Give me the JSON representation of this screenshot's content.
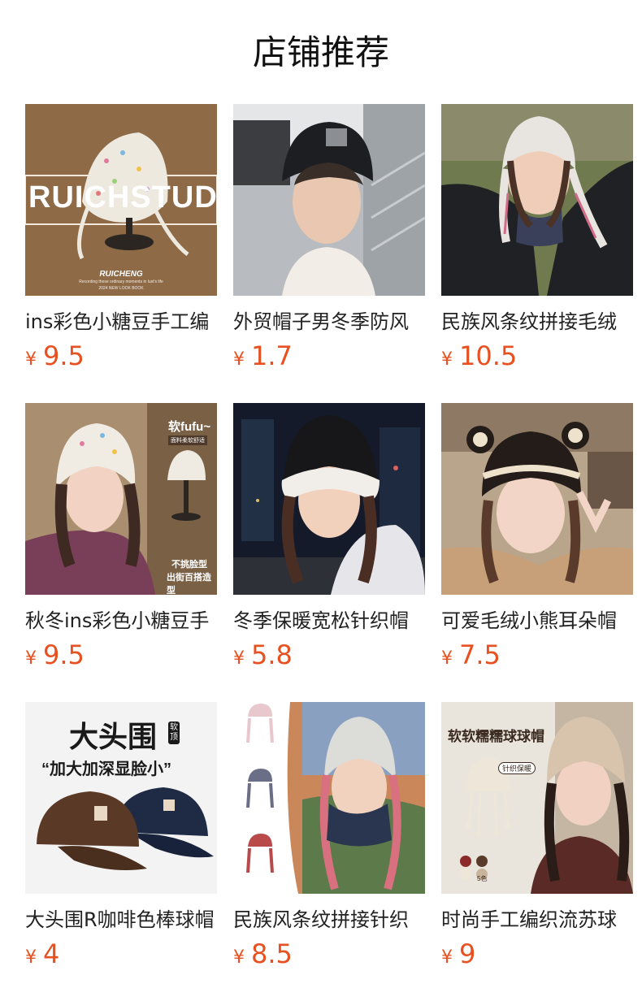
{
  "page": {
    "title": "店铺推荐"
  },
  "currency": "¥",
  "colors": {
    "price": "#e8511f",
    "text": "#222222"
  },
  "products": [
    {
      "name": "ins彩色小糖豆手工编",
      "price": "9.5",
      "image": {
        "icon": "knit-beanie-image",
        "overlay_big": "RUICHSTUDIO",
        "overlay_brand": "RUICHENG",
        "overlay_small": "Recording these ordinary moments in lust's life",
        "overlay_sub": "2024 NEW LOOK BOOK"
      }
    },
    {
      "name": "外贸帽子男冬季防风",
      "price": "1.7",
      "image": {
        "icon": "black-beanie-model-image"
      }
    },
    {
      "name": "民族风条纹拼接毛绒",
      "price": "10.5",
      "image": {
        "icon": "earflap-hat-model-image"
      }
    },
    {
      "name": "秋冬ins彩色小糖豆手",
      "price": "9.5",
      "image": {
        "icon": "fluffy-hat-model-image",
        "overlay_title": "软fufu~",
        "overlay_tag": "面料柔软舒适",
        "overlay_line1": "不挑脸型",
        "overlay_line2": "出街百搭造型"
      }
    },
    {
      "name": "冬季保暖宽松针织帽",
      "price": "5.8",
      "image": {
        "icon": "two-tone-knit-hat-image"
      }
    },
    {
      "name": "可爱毛绒小熊耳朵帽",
      "price": "7.5",
      "image": {
        "icon": "bear-ear-hat-image"
      }
    },
    {
      "name": "大头围R咖啡色棒球帽",
      "price": "4",
      "image": {
        "icon": "baseball-caps-image",
        "overlay_title": "大头围",
        "overlay_badge": "软顶",
        "overlay_quote": "“加大加深显脸小”"
      }
    },
    {
      "name": "民族风条纹拼接针织",
      "price": "8.5",
      "image": {
        "icon": "striped-earflap-hat-image"
      }
    },
    {
      "name": "时尚手工编织流苏球",
      "price": "9",
      "image": {
        "icon": "tassel-ball-hat-image",
        "overlay_title": "软软糯糯球球帽",
        "overlay_tag": "针织保暖",
        "overlay_colors": "5色"
      }
    }
  ]
}
